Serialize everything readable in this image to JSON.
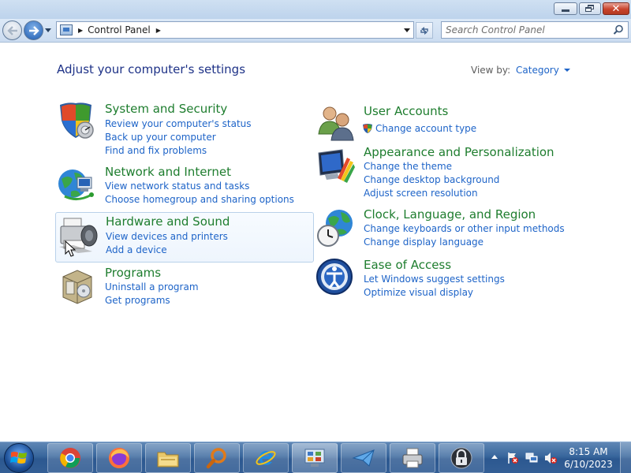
{
  "window": {
    "minimize_icon": "minimize-icon",
    "maximize_icon": "restore-icon",
    "close_icon": "close-icon"
  },
  "navigation": {
    "back_icon": "back-arrow-icon",
    "forward_icon": "forward-arrow-icon",
    "breadcrumb": [
      "Control Panel"
    ],
    "refresh_icon": "refresh-icon"
  },
  "search": {
    "placeholder": "Search Control Panel",
    "value": ""
  },
  "content": {
    "heading": "Adjust your computer's settings",
    "view_by_label": "View by:",
    "view_by_value": "Category"
  },
  "categories": {
    "system": {
      "title": "System and Security",
      "icon": "shield-icon",
      "links": [
        "Review your computer's status",
        "Back up your computer",
        "Find and fix problems"
      ]
    },
    "network": {
      "title": "Network and Internet",
      "icon": "network-globe-icon",
      "links": [
        "View network status and tasks",
        "Choose homegroup and sharing options"
      ]
    },
    "hardware": {
      "title": "Hardware and Sound",
      "icon": "printer-speaker-icon",
      "links": [
        "View devices and printers",
        "Add a device"
      ]
    },
    "programs": {
      "title": "Programs",
      "icon": "programs-box-icon",
      "links": [
        "Uninstall a program",
        "Get programs"
      ]
    },
    "users": {
      "title": "User Accounts",
      "icon": "users-icon",
      "links": [
        "Change account type"
      ]
    },
    "appearance": {
      "title": "Appearance and Personalization",
      "icon": "monitor-palette-icon",
      "links": [
        "Change the theme",
        "Change desktop background",
        "Adjust screen resolution"
      ]
    },
    "clock": {
      "title": "Clock, Language, and Region",
      "icon": "clock-globe-icon",
      "links": [
        "Change keyboards or other input methods",
        "Change display language"
      ]
    },
    "ease": {
      "title": "Ease of Access",
      "icon": "ease-of-access-icon",
      "links": [
        "Let Windows suggest settings",
        "Optimize visual display"
      ]
    }
  },
  "taskbar": {
    "start_icon": "windows-start-icon",
    "pinned": [
      "chrome-icon",
      "firefox-icon",
      "file-explorer-icon",
      "search-magnifier-icon",
      "internet-explorer-icon",
      "control-panel-icon",
      "send-icon",
      "printer-icon",
      "lock-icon"
    ],
    "tray_icons": [
      "show-hidden-icons",
      "action-center-flag-icon",
      "network-icon",
      "volume-muted-icon"
    ],
    "time": "8:15 AM",
    "date": "6/10/2023"
  },
  "colors": {
    "link": "#1e64c8",
    "category_title": "#1e7d2e",
    "heading": "#1e3287",
    "taskbar": "#2c5890"
  }
}
